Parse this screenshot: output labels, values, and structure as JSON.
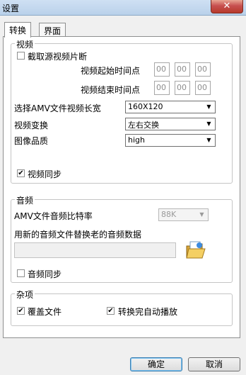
{
  "window": {
    "title": "设置",
    "close_label": "✕"
  },
  "tabs": [
    {
      "label": "转换"
    },
    {
      "label": "界面"
    }
  ],
  "video": {
    "legend": "视频",
    "trim_label": "截取源视频片断",
    "trim_checked": false,
    "start_label": "视频起始时间点",
    "end_label": "视频结束时间点",
    "start_time": [
      "00",
      "00",
      "00"
    ],
    "end_time": [
      "00",
      "00",
      "00"
    ],
    "length_label": "选择AMV文件视频长宽",
    "length_value": "160X120",
    "transform_label": "视频变换",
    "transform_value": "左右交换",
    "quality_label": "图像品质",
    "quality_value": "high",
    "sync_label": "视频同步",
    "sync_checked": true
  },
  "audio": {
    "legend": "音频",
    "bitrate_label": "AMV文件音频比特率",
    "bitrate_value": "88K",
    "replace_label": "用新的音频文件替换老的音频数据",
    "replace_value": "",
    "sync_label": "音频同步",
    "sync_checked": false
  },
  "misc": {
    "legend": "杂项",
    "overwrite_label": "覆盖文件",
    "overwrite_checked": true,
    "autoplay_label": "转换完自动播放",
    "autoplay_checked": true
  },
  "buttons": {
    "ok": "确定",
    "cancel": "取消"
  },
  "icons": {
    "check": "✔",
    "dropdown": "▼"
  }
}
